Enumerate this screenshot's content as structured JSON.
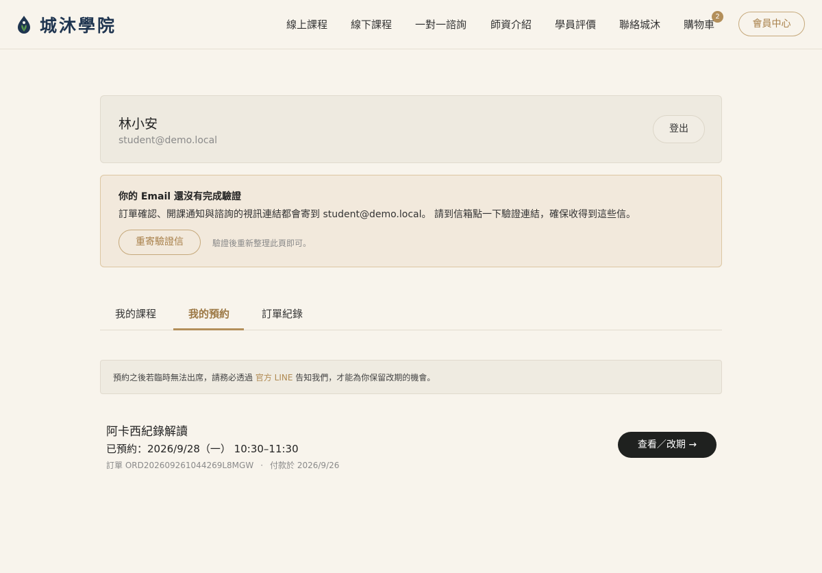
{
  "brand": {
    "name": "城沐學院"
  },
  "nav": {
    "items": [
      {
        "label": "線上課程"
      },
      {
        "label": "線下課程"
      },
      {
        "label": "一對一諮詢"
      },
      {
        "label": "師資介紹"
      },
      {
        "label": "學員評價"
      },
      {
        "label": "聯絡城沐"
      },
      {
        "label": "購物車"
      }
    ],
    "cart_count": "2",
    "member_label": "會員中心"
  },
  "profile": {
    "name": "林小安",
    "email": "student@demo.local",
    "logout_label": "登出"
  },
  "verify": {
    "title": "你的 Email 還沒有完成驗證",
    "description": "訂單確認、開課通知與諮詢的視訊連結都會寄到 student@demo.local。 請到信箱點一下驗證連結，確保收得到這些信。",
    "resend_label": "重寄驗證信",
    "hint": "驗證後重新整理此頁即可。"
  },
  "tabs": [
    {
      "label": "我的課程"
    },
    {
      "label": "我的預約"
    },
    {
      "label": "訂單紀錄"
    }
  ],
  "notice": {
    "before": "預約之後若臨時無法出席，請務必透過 ",
    "link": "官方 LINE",
    "after": " 告知我們，才能為你保留改期的機會。"
  },
  "booking": {
    "title": "阿卡西紀錄解讀",
    "time": "已預約：2026/9/28（一） 10:30–11:30",
    "order": "訂單 ORD202609261044269L8MGW",
    "separator": "·",
    "paid": "付款於 2026/9/26",
    "action_label": "查看／改期 →"
  },
  "colors": {
    "background": "#f8f4ec",
    "accent": "#b38f5a",
    "brand_navy": "#1f3550",
    "brand_green": "#4a8a4a"
  }
}
